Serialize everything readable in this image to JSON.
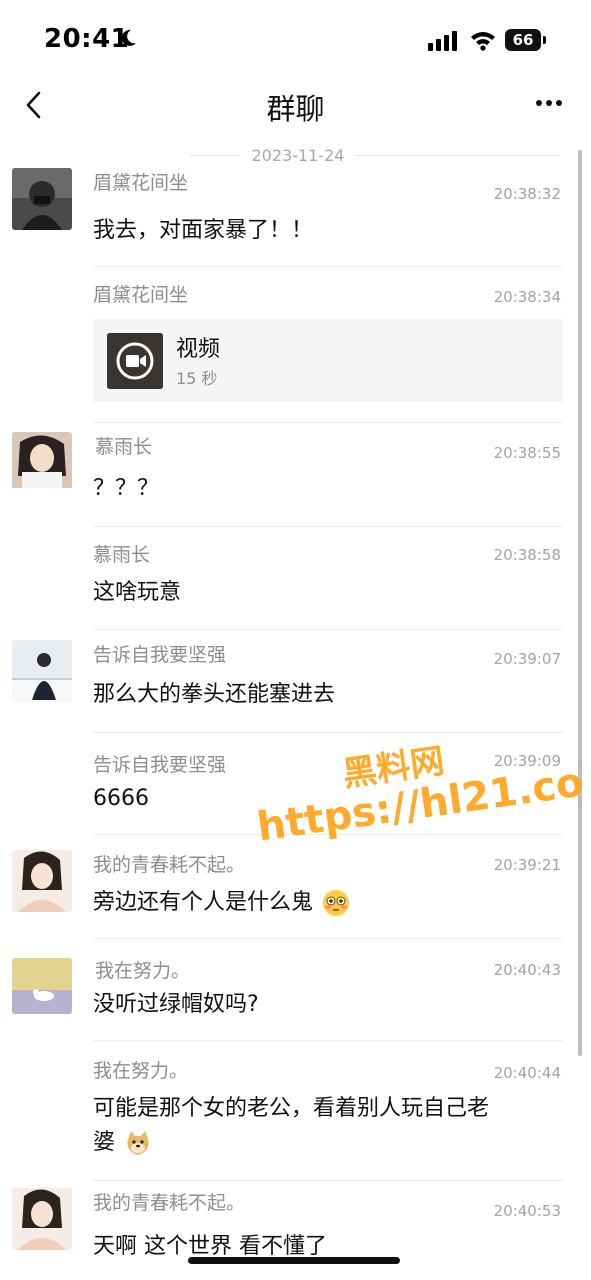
{
  "status": {
    "time": "20:41",
    "battery": "66"
  },
  "nav": {
    "title": "群聊"
  },
  "date_separator": "2023-11-24",
  "messages": [
    {
      "sender": "眉黛花间坐",
      "time": "20:38:32",
      "text": "我去，对面家暴了！！"
    },
    {
      "sender": "眉黛花间坐",
      "time": "20:38:34",
      "video": {
        "title": "视频",
        "duration": "15 秒"
      }
    },
    {
      "sender": "慕雨长",
      "time": "20:38:55",
      "text": "？？？"
    },
    {
      "sender": "慕雨长",
      "time": "20:38:58",
      "text": "这啥玩意"
    },
    {
      "sender": "告诉自我要坚强",
      "time": "20:39:07",
      "text": "那么大的拳头还能塞进去"
    },
    {
      "sender": "告诉自我要坚强",
      "time": "20:39:09",
      "text": "6666"
    },
    {
      "sender": "我的青春耗不起。",
      "time": "20:39:21",
      "text": "旁边还有个人是什么鬼",
      "emoji": "flushed-face"
    },
    {
      "sender": "我在努力。",
      "time": "20:40:43",
      "text": "没听过绿帽奴吗?"
    },
    {
      "sender": "我在努力。",
      "time": "20:40:44",
      "text_line1": "可能是那个女的老公，看着别人玩自己老",
      "text_line2": "婆",
      "emoji": "doge"
    },
    {
      "sender": "我的青春耗不起。",
      "time": "20:40:53",
      "text": "天啊 这个世界 看不懂了"
    }
  ],
  "watermark": {
    "line1": "黑料网",
    "line2": "https://hl21.co"
  },
  "colors": {
    "watermark": "#ffa31a",
    "secondary_text": "#8e8e8e"
  }
}
